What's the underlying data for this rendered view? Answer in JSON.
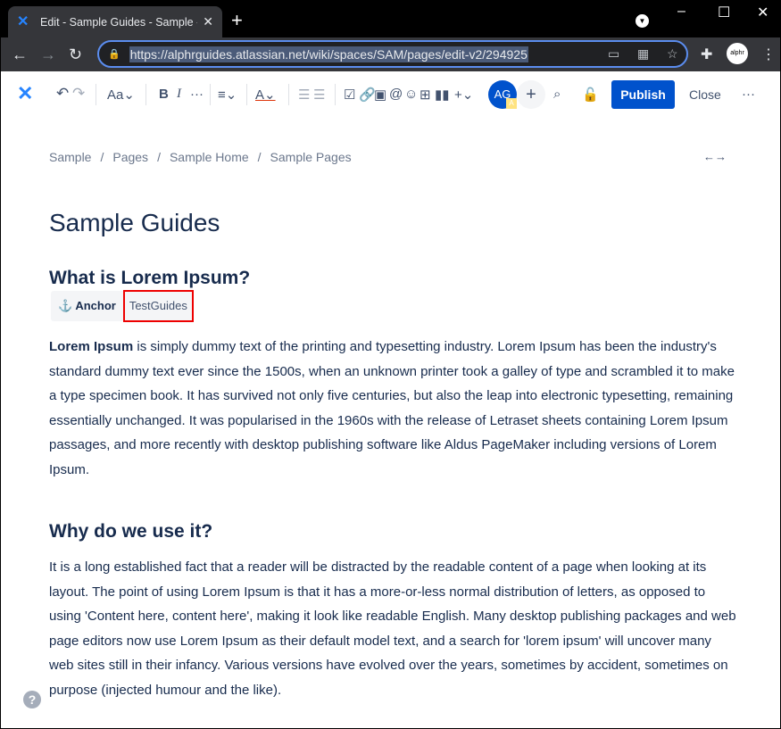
{
  "browser": {
    "tab_title": "Edit - Sample Guides - Sample - C",
    "url": "https://alphrguides.atlassian.net/wiki/spaces/SAM/pages/edit-v2/294925",
    "profile": "alphr"
  },
  "toolbar": {
    "text_style": "Aa",
    "avatar_initials": "AG",
    "avatar_badge": "A",
    "publish": "Publish",
    "close": "Close"
  },
  "breadcrumb": [
    "Sample",
    "Pages",
    "Sample Home",
    "Sample Pages"
  ],
  "page": {
    "title": "Sample Guides",
    "h1": "What is Lorem Ipsum?",
    "anchor_label": "Anchor",
    "anchor_name": "TestGuides",
    "p1_bold": "Lorem Ipsum",
    "p1": " is simply dummy text of the printing and typesetting industry. Lorem Ipsum has been the industry's standard dummy text ever since the 1500s, when an unknown printer took a galley of type and scrambled it to make a type specimen book. It has survived not only five centuries, but also the leap into electronic typesetting, remaining essentially unchanged. It was popularised in the 1960s with the release of Letraset sheets containing Lorem Ipsum passages, and more recently with desktop publishing software like Aldus PageMaker including versions of Lorem Ipsum.",
    "h2": "Why do we use it?",
    "p2": "It is a long established fact that a reader will be distracted by the readable content of a page when looking at its layout. The point of using Lorem Ipsum is that it has a more-or-less normal distribution of letters, as opposed to using 'Content here, content here', making it look like readable English. Many desktop publishing packages and web page editors now use Lorem Ipsum as their default model text, and a search for 'lorem ipsum' will uncover many web sites still in their infancy. Various versions have evolved over the years, sometimes by accident, sometimes on purpose (injected humour and the like)."
  },
  "colors": {
    "primary": "#0052cc",
    "highlight_border": "#e00000"
  }
}
